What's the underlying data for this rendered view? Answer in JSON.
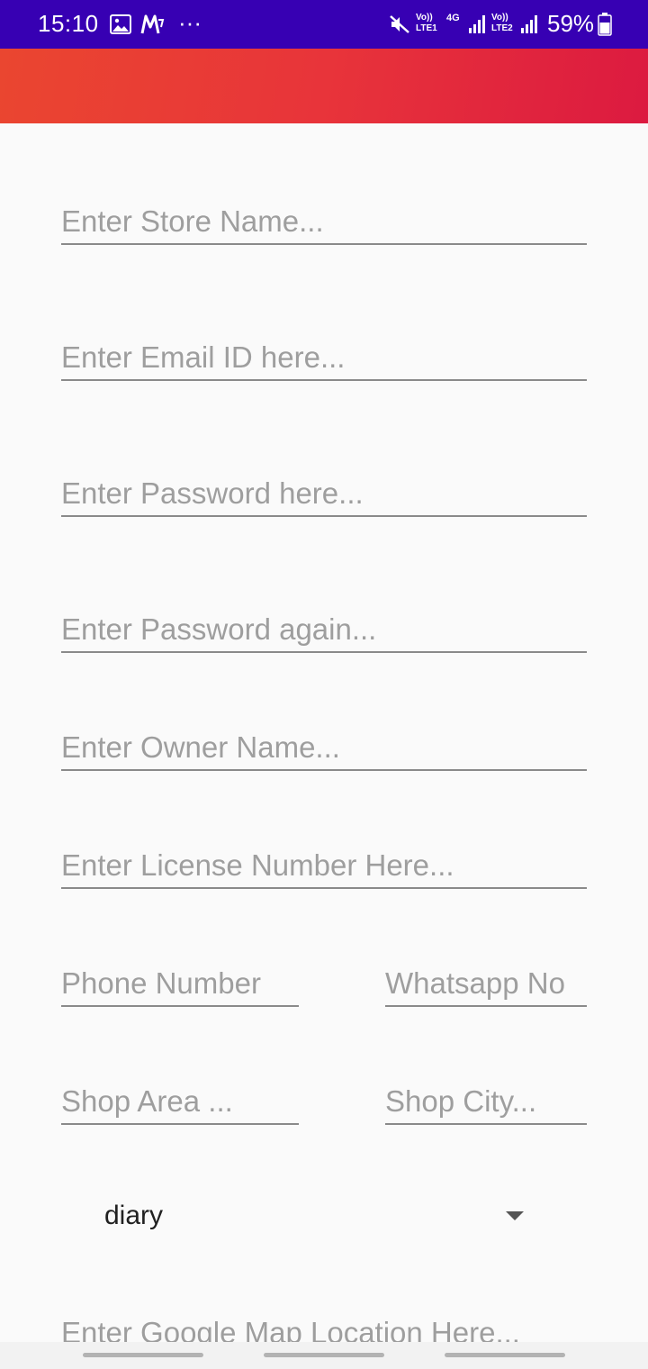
{
  "status_bar": {
    "time": "15:10",
    "battery": "59%",
    "overflow": "···",
    "signal_1_label": "Vo)) LTE1",
    "network_type": "4G",
    "signal_2_label": "Vo)) LTE2"
  },
  "form": {
    "store_name_placeholder": "Enter Store Name...",
    "email_placeholder": "Enter Email ID here...",
    "password_placeholder": "Enter Password here...",
    "password_again_placeholder": "Enter Password again...",
    "owner_name_placeholder": "Enter Owner Name...",
    "license_placeholder": "Enter License Number Here...",
    "phone_placeholder": "Phone Number",
    "whatsapp_placeholder": "Whatsapp No",
    "shop_area_placeholder": "Shop Area ...",
    "shop_city_placeholder": "Shop City...",
    "category_value": "diary",
    "map_location_placeholder": "Enter Google Map Location Here..."
  },
  "colors": {
    "status_bar": "#3700b3",
    "header_start": "#ea4630",
    "header_end": "#dc1a40"
  }
}
